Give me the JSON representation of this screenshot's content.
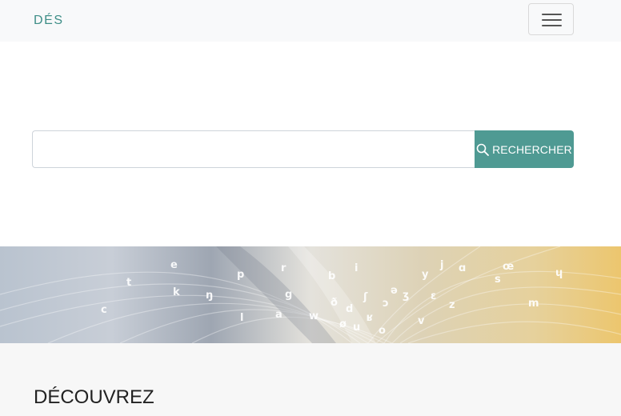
{
  "navbar": {
    "brand": "DÉS",
    "menu_toggle_icon": "hamburger-icon"
  },
  "search": {
    "value": "",
    "placeholder": "",
    "button_label": "RECHERCHER",
    "button_icon": "search-icon",
    "button_color": "#4f9a93"
  },
  "banner": {
    "letters": [
      "e",
      "p",
      "r",
      "b",
      "i",
      "k",
      "ŋ",
      "g",
      "ð",
      "d",
      "ʃ",
      "ɔ",
      "ʒ",
      "y",
      "ɑ",
      "œ",
      "ɥ",
      "s",
      "ɛ",
      "ə",
      "z",
      "m",
      "w",
      "ø",
      "u",
      "o",
      "v",
      "ʁ",
      "t",
      "l",
      "j",
      "a",
      "c"
    ]
  },
  "discover": {
    "heading": "DÉCOUVREZ"
  },
  "colors": {
    "brand": "#3e8e87",
    "navbar_bg": "#f8f9fa",
    "accent": "#4f9a93"
  }
}
